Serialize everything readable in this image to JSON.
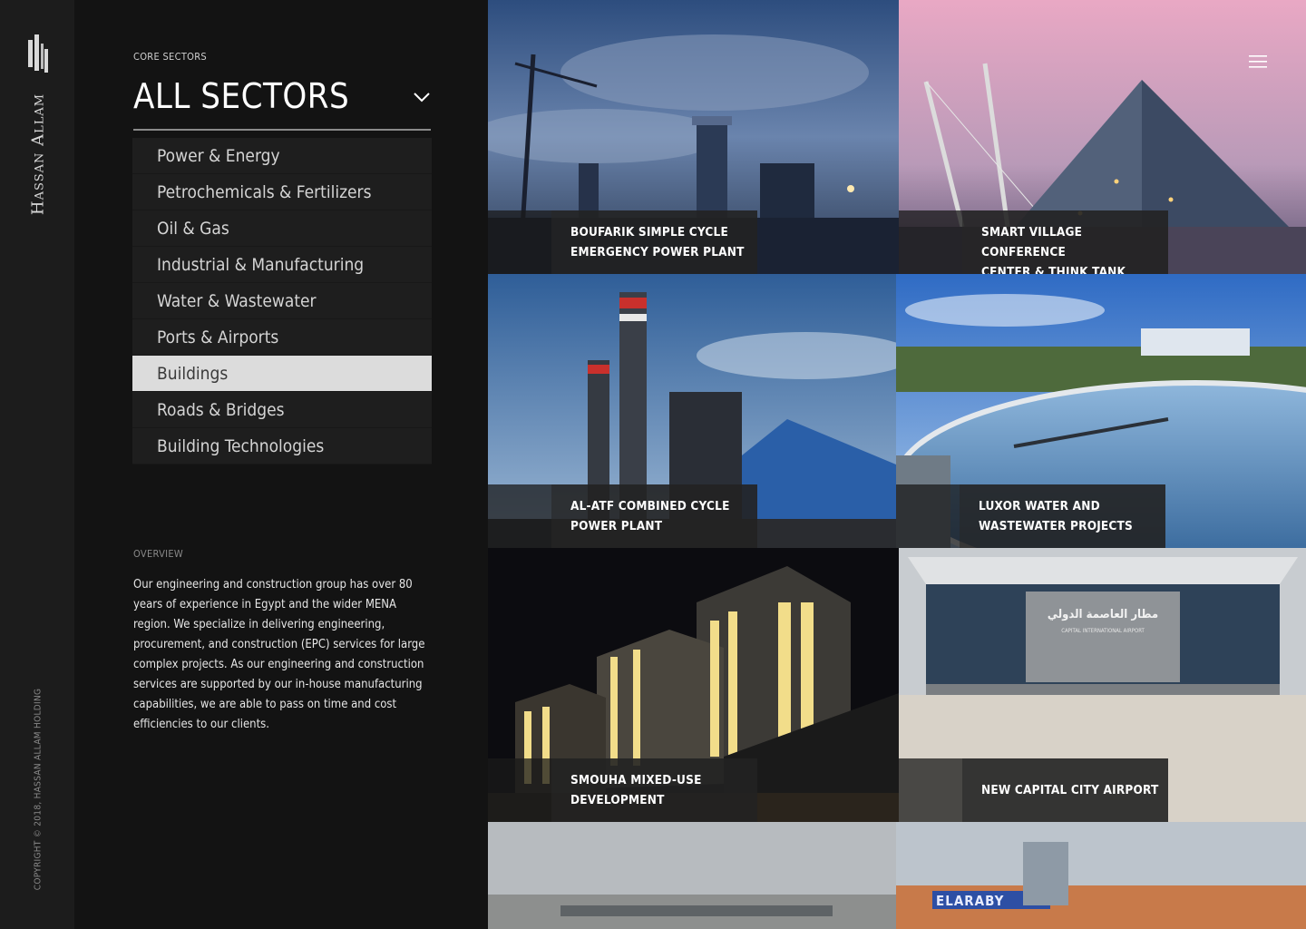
{
  "brand": {
    "name": "Hassan Allam",
    "copyright": "COPYRIGHT © 2018, HASSAN ALLAM HOLDING"
  },
  "sectors": {
    "label": "CORE SECTORS",
    "title": "ALL SECTORS",
    "items": [
      {
        "label": "Power & Energy"
      },
      {
        "label": "Petrochemicals & Fertilizers"
      },
      {
        "label": "Oil & Gas"
      },
      {
        "label": "Industrial & Manufacturing"
      },
      {
        "label": "Water & Wastewater"
      },
      {
        "label": "Ports & Airports"
      },
      {
        "label": "Buildings",
        "active": true
      },
      {
        "label": "Roads & Bridges"
      },
      {
        "label": "Building Technologies"
      }
    ]
  },
  "overview": {
    "label": "OVERVIEW",
    "text": "Our engineering and construction group has over 80 years of experience in Egypt and the wider MENA region. We specialize in delivering engineering, procurement, and construction (EPC) services for large complex projects. As our engineering and construction services are supported by our in-house manufacturing capabilities, we are able to pass on time and cost efficiencies to our clients."
  },
  "projects": [
    {
      "title_line1": "BOUFARIK SIMPLE CYCLE",
      "title_line2": "EMERGENCY POWER PLANT"
    },
    {
      "title_line1": "SMART VILLAGE CONFERENCE",
      "title_line2": "CENTER & THINK TANK"
    },
    {
      "title_line1": "AL-ATF COMBINED CYCLE",
      "title_line2": "POWER PLANT"
    },
    {
      "title_line1": "LUXOR WATER AND",
      "title_line2": "WASTEWATER PROJECTS"
    },
    {
      "title_line1": "SMOUHA MIXED-USE",
      "title_line2": "DEVELOPMENT"
    },
    {
      "title_line1": "",
      "title_line2": "NEW CAPITAL CITY AIRPORT"
    }
  ],
  "airport_sign": {
    "arabic": "مطار العاصمة الدولي",
    "english": "CAPITAL INTERNATIONAL AIRPORT"
  },
  "store_sign": "ELARABY",
  "icons": {
    "menu": "hamburger-menu-icon",
    "chevron": "chevron-down-icon",
    "logo": "hassan-allam-logo-icon"
  }
}
